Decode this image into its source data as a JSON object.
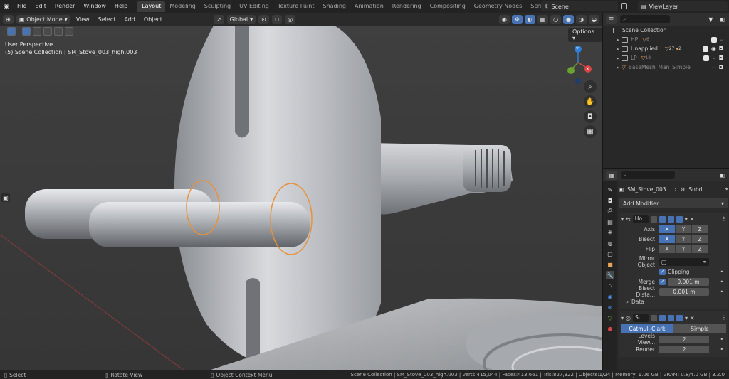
{
  "menu": [
    "File",
    "Edit",
    "Render",
    "Window",
    "Help"
  ],
  "workspaces": [
    {
      "label": "Layout",
      "active": true
    },
    {
      "label": "Modeling"
    },
    {
      "label": "Sculpting"
    },
    {
      "label": "UV Editing"
    },
    {
      "label": "Texture Paint"
    },
    {
      "label": "Shading"
    },
    {
      "label": "Animation"
    },
    {
      "label": "Rendering"
    },
    {
      "label": "Compositing"
    },
    {
      "label": "Geometry Nodes"
    },
    {
      "label": "Scripting"
    }
  ],
  "workspace_add": "+",
  "scene": {
    "name": "Scene"
  },
  "view_layer": {
    "name": "ViewLayer"
  },
  "viewport_header": {
    "mode": "Object Mode",
    "menus": [
      "View",
      "Select",
      "Add",
      "Object"
    ],
    "transform": "Global",
    "options": "Options"
  },
  "viewport": {
    "perspective": "User Perspective",
    "collection_info": "(5) Scene Collection | SM_Stove_003_high.003"
  },
  "gizmo": {
    "x": "X",
    "y": "Y",
    "z": "Z"
  },
  "outliner": {
    "root": "Scene Collection",
    "rows": [
      {
        "name": "HP",
        "badge": "6",
        "dim": true
      },
      {
        "name": "Unapplied",
        "badge": "27",
        "badge2": "2",
        "dim": false
      },
      {
        "name": "LP",
        "badge": "18",
        "dim": true
      },
      {
        "name": "BaseMesh_Man_Simple",
        "dim": true
      }
    ]
  },
  "properties": {
    "object": "SM_Stove_003...",
    "modifier_crumb": "Subdi...",
    "add_modifier": "Add Modifier",
    "mirror": {
      "name": "Ho...",
      "axis_label": "Axis",
      "bisect_label": "Bisect",
      "flip_label": "Flip",
      "x": "X",
      "y": "Y",
      "z": "Z",
      "mirror_object_label": "Mirror Object",
      "clipping_label": "Clipping",
      "merge_label": "Merge",
      "merge_value": "0.001 m",
      "bisect_distance_label": "Bisect Dista...",
      "bisect_distance_value": "0.001 m",
      "data_label": "Data"
    },
    "subsurf": {
      "name": "Su...",
      "catmull": "Catmull-Clark",
      "simple": "Simple",
      "levels_viewport_label": "Levels View...",
      "levels_viewport_value": "2",
      "render_label": "Render",
      "render_value": "2"
    }
  },
  "statusbar": {
    "select": "Select",
    "rotate": "Rotate View",
    "context": "Object Context Menu",
    "stats": "Scene Collection | SM_Stove_003_high.003 | Verts:415,044 | Faces:413,661 | Tris:827,322 | Objects:1/24 | Memory: 1.06 GB | VRAM: 0.8/4.0 GB | 3.2.0"
  },
  "colors": {
    "accent": "#4772b3",
    "selection_outline": "#e8913a"
  }
}
